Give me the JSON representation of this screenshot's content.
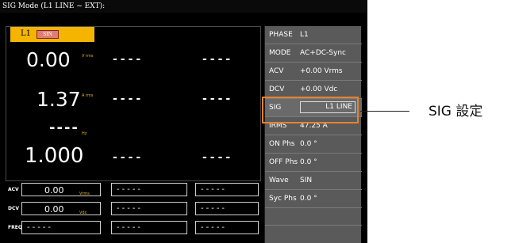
{
  "title": "SIG Mode (L1 LINE ~ EXT):",
  "channel": {
    "label": "L1",
    "badge": "SIN"
  },
  "readouts": [
    {
      "value": "0.00",
      "unit": "V rms"
    },
    {
      "value": "1.37",
      "unit": "A rms"
    },
    {
      "value": "----",
      "unit": "Hz"
    },
    {
      "value": "1.000",
      "unit": ""
    }
  ],
  "placeholder_dashes": "----",
  "bottom": {
    "rows": [
      {
        "label": "ACV",
        "value": "0.00",
        "unit": "Vrms"
      },
      {
        "label": "DCV",
        "value": "0.00",
        "unit": "Vdc"
      },
      {
        "label": "FREQ",
        "value": "-----",
        "unit": ""
      }
    ],
    "empty_dashes": "-----"
  },
  "side_panel": [
    {
      "key": "PHASE",
      "value": "L1"
    },
    {
      "key": "MODE",
      "value": "AC+DC-Sync"
    },
    {
      "key": "ACV",
      "value": "+0.00 Vrms"
    },
    {
      "key": "DCV",
      "value": "+0.00 Vdc"
    },
    {
      "key": "SIG",
      "value": "L1 LINE"
    },
    {
      "key": "IRMS",
      "value": "47.25 A"
    },
    {
      "key": "ON Phs",
      "value": "0.0 °"
    },
    {
      "key": "OFF Phs",
      "value": "0.0 °"
    },
    {
      "key": "Wave",
      "value": "SIN"
    },
    {
      "key": "Syc Phs",
      "value": "0.0 °"
    }
  ],
  "callout": "SIG 設定",
  "colors": {
    "accent": "#f4b400",
    "highlight": "#e8822d",
    "panel": "#5a5a5a",
    "unit": "#e3b62a"
  }
}
